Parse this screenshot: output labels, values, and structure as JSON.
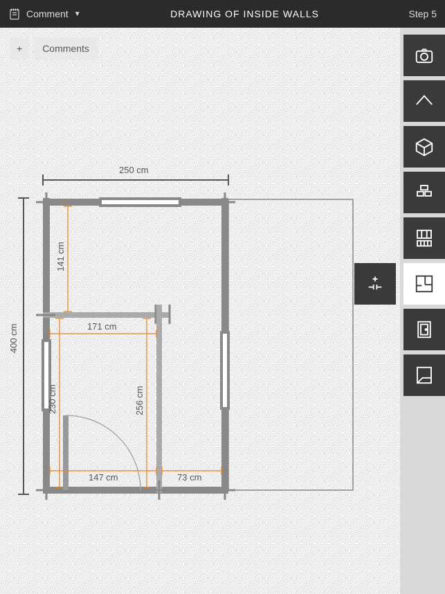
{
  "topbar": {
    "comment_label": "Comment",
    "title": "DRAWING OF INSIDE WALLS",
    "step_label": "Step 5"
  },
  "toolbar": {
    "add_label": "+",
    "comments_label": "Comments"
  },
  "dimensions": {
    "outer_w": "250 cm",
    "outer_h": "400 cm",
    "upper_room_h": "141 cm",
    "inner_w": "171 cm",
    "lower_room_h": "230 cm",
    "inner_h": "256 cm",
    "door_w": "147 cm",
    "right_gap": "73 cm"
  },
  "side_tools": {
    "camera": "camera-icon",
    "roof": "roof-icon",
    "cube": "cube-icon",
    "stack": "stack-icon",
    "grid": "grid-icon",
    "floorplan": "floorplan-icon",
    "door": "door-icon",
    "page": "page-icon",
    "snap": "snap-icon"
  }
}
